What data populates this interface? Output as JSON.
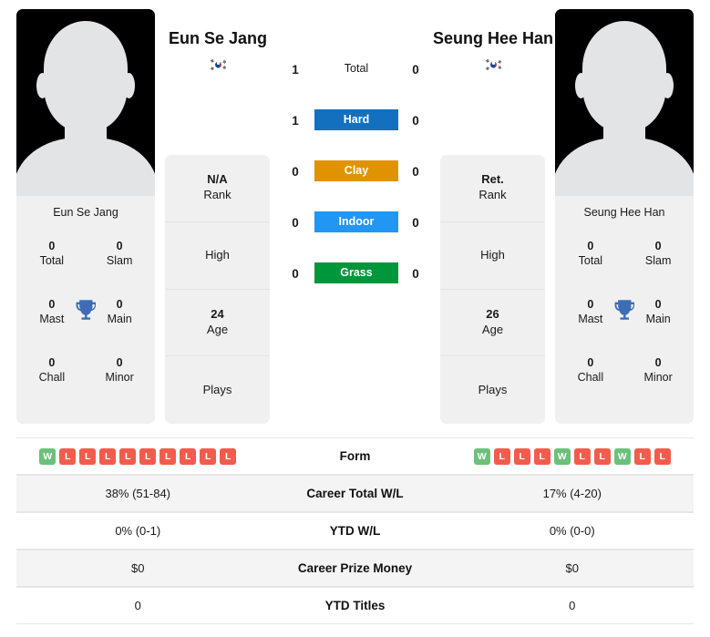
{
  "players": {
    "left": {
      "name": "Eun Se Jang",
      "photo_caption": "Eun Se Jang",
      "flag": "south-korea-flag",
      "titles": {
        "total": "0",
        "total_label": "Total",
        "slam": "0",
        "slam_label": "Slam",
        "mast": "0",
        "mast_label": "Mast",
        "main": "0",
        "main_label": "Main",
        "chall": "0",
        "chall_label": "Chall",
        "minor": "0",
        "minor_label": "Minor"
      },
      "stats": {
        "rank_value": "N/A",
        "rank_label": "Rank",
        "high_value": "",
        "high_label": "High",
        "age_value": "24",
        "age_label": "Age",
        "plays_value": "",
        "plays_label": "Plays"
      },
      "form": [
        "W",
        "L",
        "L",
        "L",
        "L",
        "L",
        "L",
        "L",
        "L",
        "L"
      ],
      "career_total_wl": "38% (51-84)",
      "ytd_wl": "0% (0-1)",
      "career_prize_money": "$0",
      "ytd_titles": "0"
    },
    "right": {
      "name": "Seung Hee Han",
      "photo_caption": "Seung Hee Han",
      "flag": "south-korea-flag",
      "titles": {
        "total": "0",
        "total_label": "Total",
        "slam": "0",
        "slam_label": "Slam",
        "mast": "0",
        "mast_label": "Mast",
        "main": "0",
        "main_label": "Main",
        "chall": "0",
        "chall_label": "Chall",
        "minor": "0",
        "minor_label": "Minor"
      },
      "stats": {
        "rank_value": "Ret.",
        "rank_label": "Rank",
        "high_value": "",
        "high_label": "High",
        "age_value": "26",
        "age_label": "Age",
        "plays_value": "",
        "plays_label": "Plays"
      },
      "form": [
        "W",
        "L",
        "L",
        "L",
        "W",
        "L",
        "L",
        "W",
        "L",
        "L"
      ],
      "career_total_wl": "17% (4-20)",
      "ytd_wl": "0% (0-0)",
      "career_prize_money": "$0",
      "ytd_titles": "0"
    }
  },
  "head_to_head": [
    {
      "label": "Total",
      "left": "1",
      "right": "0",
      "color": ""
    },
    {
      "label": "Hard",
      "left": "1",
      "right": "0",
      "color": "#1270BE"
    },
    {
      "label": "Clay",
      "left": "0",
      "right": "0",
      "color": "#E09300"
    },
    {
      "label": "Indoor",
      "left": "0",
      "right": "0",
      "color": "#2196F3"
    },
    {
      "label": "Grass",
      "left": "0",
      "right": "0",
      "color": "#00963C"
    }
  ],
  "table_labels": {
    "form": "Form",
    "career_total_wl": "Career Total W/L",
    "ytd_wl": "YTD W/L",
    "career_prize_money": "Career Prize Money",
    "ytd_titles": "YTD Titles"
  },
  "colors": {
    "win_badge": "#6BC17A",
    "loss_badge": "#F25C4C",
    "trophy": "#3E6DB5",
    "card_bg": "#F0F0F0",
    "row_shaded": "#F4F4F4"
  }
}
